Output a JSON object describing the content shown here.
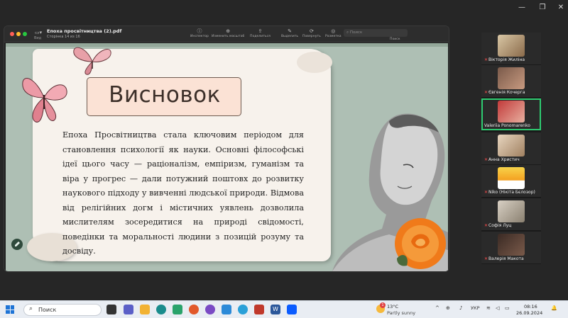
{
  "viewer": {
    "view_label": "Вид",
    "doc_title": "Епоха просвітництва (2).pdf",
    "doc_pages": "Сторінка 14 из 16",
    "tools": [
      {
        "icon": "ⓘ",
        "label": "Инспектор"
      },
      {
        "icon": "⊕",
        "label": "Изменить масштаб"
      },
      {
        "icon": "⇪",
        "label": "Поделиться"
      },
      {
        "icon": "✎",
        "label": "Выделить"
      },
      {
        "icon": "⟳",
        "label": "Повернуть"
      },
      {
        "icon": "◎",
        "label": "Разметка"
      }
    ],
    "search_placeholder": "Поиск",
    "search_label": "Поиск"
  },
  "slide": {
    "title": "Висновок",
    "body": "Епоха Просвітництва стала ключовим періодом для становлення психології як науки. Основні філософські ідеї цього часу — раціоналізм, емпіризм, гуманізм та віра у прогрес — дали потужний поштовх до розвитку наукового підходу у вивченні людської природи. Відмова від релігійних догм і містичних уявлень дозволила мислителям зосередитися на природі свідомості, поведінки та моральності людини з позицій розуму та досвіду."
  },
  "participants": [
    {
      "name": "Вікторія Жиліна",
      "muted": true
    },
    {
      "name": "Євгенія Кочерга",
      "muted": true
    },
    {
      "name": "Valeriia Ponomarenko",
      "muted": false
    },
    {
      "name": "Анна Христич",
      "muted": true
    },
    {
      "name": "Niko (Нікіта Бєлозор)",
      "muted": true
    },
    {
      "name": "Софія Луц",
      "muted": true
    },
    {
      "name": "Валерія Макота",
      "muted": true
    }
  ],
  "taskbar": {
    "search_label": "Поиск",
    "weather_temp": "13°C",
    "weather_cond": "Partly sunny",
    "weather_badge": "1",
    "language": "УКР",
    "time": "08:16",
    "date": "26.09.2024"
  },
  "colors": {
    "active_speaker": "#2ecc71",
    "slide_bg": "#aebfb4",
    "title_box": "#fbe2d5",
    "muted_mic": "#ff4d4d"
  }
}
